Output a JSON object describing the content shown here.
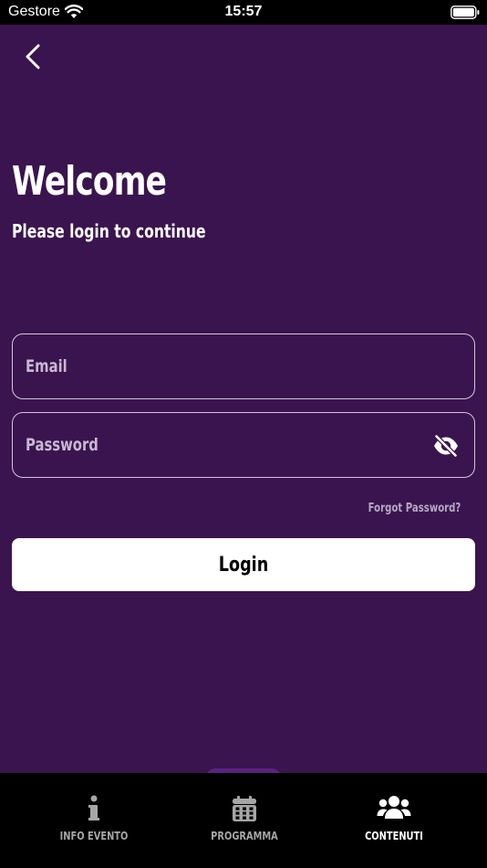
{
  "status_bar": {
    "carrier": "Gestore",
    "time": "15:57",
    "wifi_icon": "wifi-icon",
    "battery_icon": "battery-icon"
  },
  "header": {
    "back_icon": "chevron-left-icon"
  },
  "main": {
    "title": "Welcome",
    "subtitle": "Please login to continue",
    "email": {
      "placeholder": "Email",
      "value": ""
    },
    "password": {
      "placeholder": "Password",
      "value": "",
      "toggle_icon": "eye-slash-icon"
    },
    "forgot_label": "Forgot Password?",
    "login_label": "Login"
  },
  "tab_bar": {
    "tabs": [
      {
        "label": "INFO EVENTO",
        "icon": "info-icon",
        "active": false
      },
      {
        "label": "PROGRAMMA",
        "icon": "calendar-icon",
        "active": false
      },
      {
        "label": "CONTENUTI",
        "icon": "users-icon",
        "active": true
      }
    ]
  },
  "colors": {
    "background": "#3a144e",
    "field_border": "#d4c7dc",
    "placeholder": "#c9b8d2",
    "forgot_text": "#b7a7c4",
    "button_bg": "#ffffff",
    "tab_bar_bg": "#000000",
    "tab_inactive": "#a6a6a6",
    "tab_active": "#ffffff",
    "accent_notch": "#5b2280"
  }
}
